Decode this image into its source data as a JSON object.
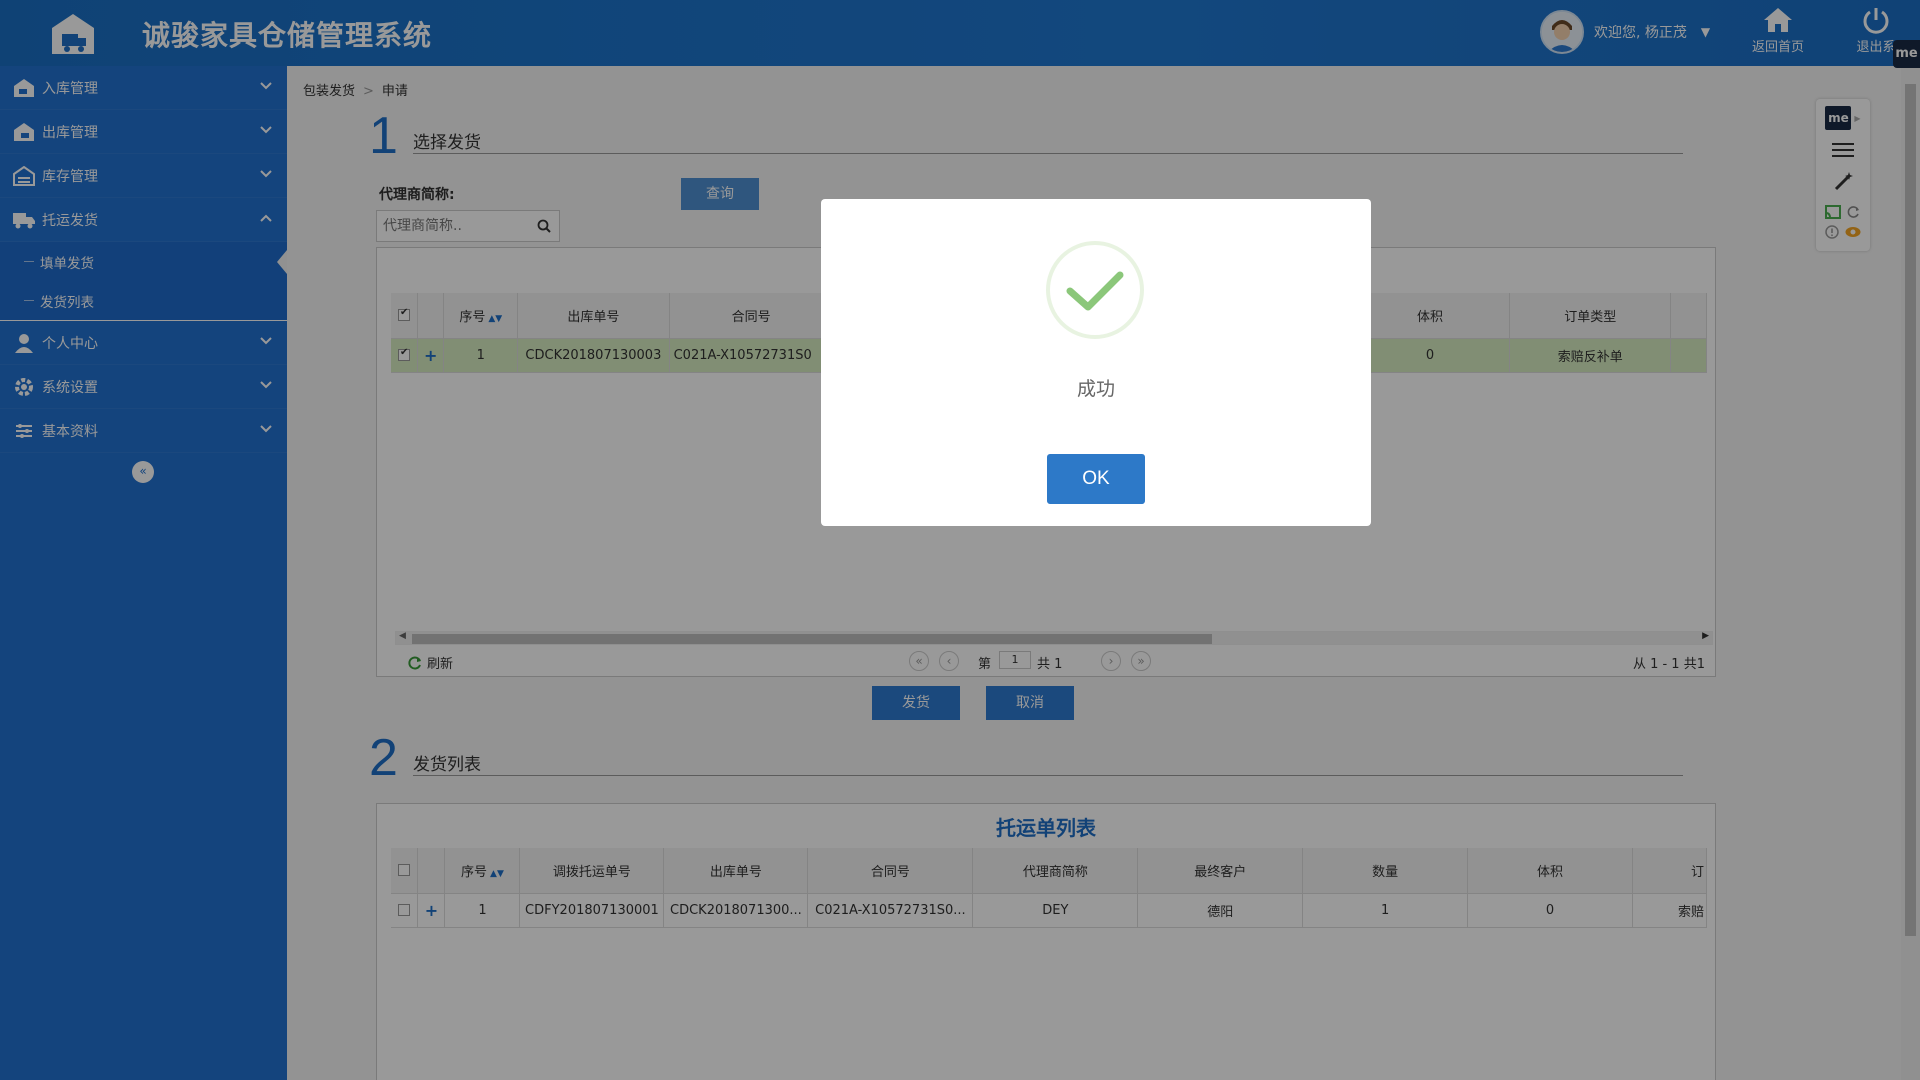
{
  "header": {
    "title": "诚骏家具仓储管理系统",
    "welcome": "欢迎您, 杨正茂",
    "home_label": "返回首页",
    "logout_label": "退出系"
  },
  "sidebar": {
    "items": [
      {
        "label": "入库管理",
        "icon": "warehouse-in-icon"
      },
      {
        "label": "出库管理",
        "icon": "warehouse-out-icon"
      },
      {
        "label": "库存管理",
        "icon": "inventory-icon"
      },
      {
        "label": "托运发货",
        "icon": "truck-icon"
      },
      {
        "label": "个人中心",
        "icon": "user-icon"
      },
      {
        "label": "系统设置",
        "icon": "gear-icon"
      },
      {
        "label": "基本资料",
        "icon": "sliders-icon"
      }
    ],
    "subitems": [
      {
        "label": "填单发货"
      },
      {
        "label": "发货列表"
      }
    ],
    "collapse_symbol": "«"
  },
  "breadcrumb": {
    "parent": "包装发货",
    "current": "申请",
    "separator": ">"
  },
  "step1": {
    "num": "1",
    "title": "选择发货",
    "agent_label": "代理商简称:",
    "agent_placeholder": "代理商简称..",
    "query_label": "查询",
    "columns": [
      "序号",
      "出库单号",
      "合同号",
      "体积",
      "订单类型"
    ],
    "rows": [
      {
        "seq": "1",
        "outbound_no": "CDCK201807130003",
        "contract_no": "C021A-X10572731S0",
        "volume": "0",
        "order_type": "索赔反补单"
      }
    ],
    "refresh_label": "刷新",
    "page_prefix": "第",
    "page_value": "1",
    "page_total": "共 1",
    "range_text": "从 1 - 1 共1",
    "ship_label": "发货",
    "cancel_label": "取消"
  },
  "step2": {
    "num": "2",
    "title": "发货列表",
    "list_title": "托运单列表",
    "columns": [
      "序号",
      "调拨托运单号",
      "出库单号",
      "合同号",
      "代理商简称",
      "最终客户",
      "数量",
      "体积",
      "订"
    ],
    "rows": [
      {
        "seq": "1",
        "transfer_no": "CDFY201807130001",
        "outbound_no": "CDCK2018071300...",
        "contract_no": "C021A-X10572731S0...",
        "agent": "DEY",
        "customer": "德阳",
        "qty": "1",
        "volume": "0",
        "order_type": "索赔"
      }
    ]
  },
  "modal": {
    "message": "成功",
    "ok_label": "OK"
  },
  "extension": {
    "badge": "me"
  },
  "colors": {
    "primary": "#2272d1",
    "success": "#8bc77a",
    "selected_row": "#d8edc1"
  }
}
